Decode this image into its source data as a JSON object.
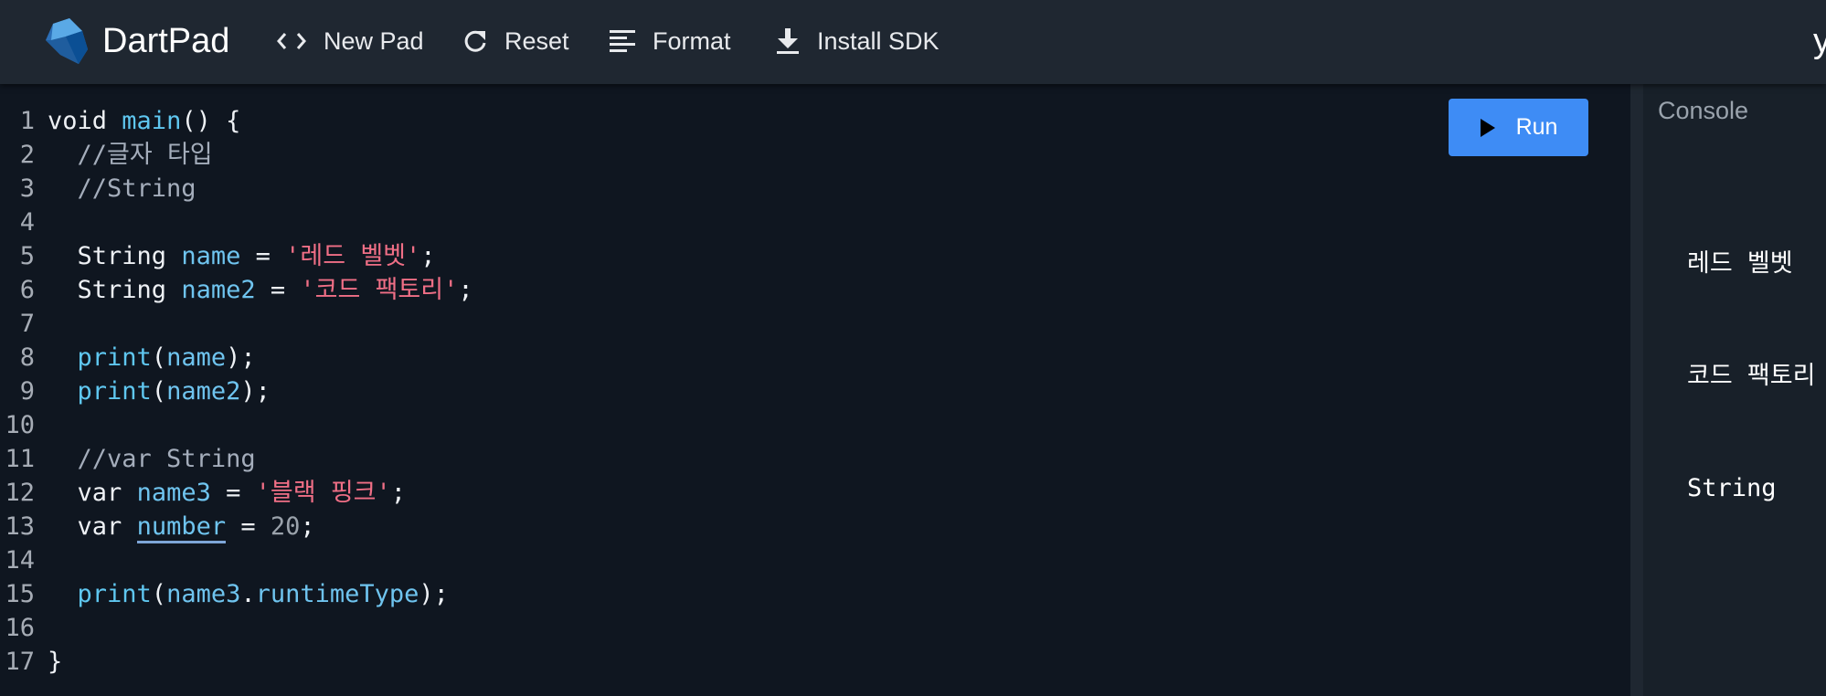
{
  "header": {
    "title": "DartPad",
    "new_pad": "New Pad",
    "reset": "Reset",
    "format": "Format",
    "install_sdk": "Install SDK",
    "cut_off_text": "y"
  },
  "editor": {
    "run_label": "Run",
    "lines": [
      {
        "n": "1"
      },
      {
        "n": "2"
      },
      {
        "n": "3"
      },
      {
        "n": "4"
      },
      {
        "n": "5"
      },
      {
        "n": "6"
      },
      {
        "n": "7"
      },
      {
        "n": "8"
      },
      {
        "n": "9"
      },
      {
        "n": "10"
      },
      {
        "n": "11"
      },
      {
        "n": "12"
      },
      {
        "n": "13"
      },
      {
        "n": "14"
      },
      {
        "n": "15"
      },
      {
        "n": "16"
      },
      {
        "n": "17"
      }
    ],
    "code": {
      "l1": {
        "kw": "void",
        "fn": "main",
        "rest": "() {"
      },
      "l2": {
        "comment": "//글자 타입"
      },
      "l3": {
        "comment": "//String"
      },
      "l5": {
        "type": "String",
        "id": "name",
        "eq": " = ",
        "str": "'레드 벨벳'",
        "end": ";"
      },
      "l6": {
        "type": "String",
        "id": "name2",
        "eq": " = ",
        "str": "'코드 팩토리'",
        "end": ";"
      },
      "l8": {
        "fn": "print",
        "open": "(",
        "arg": "name",
        "close": ");"
      },
      "l9": {
        "fn": "print",
        "open": "(",
        "arg": "name2",
        "close": ");"
      },
      "l11": {
        "comment": "//var String"
      },
      "l12": {
        "kw": "var",
        "id": "name3",
        "eq": " = ",
        "str": "'블랙 핑크'",
        "end": ";"
      },
      "l13": {
        "kw": "var",
        "id": "number",
        "eq": " = ",
        "num": "20",
        "end": ";"
      },
      "l15": {
        "fn": "print",
        "open": "(",
        "arg": "name3",
        "dot": ".",
        "prop": "runtimeType",
        "close": ");"
      },
      "l17": {
        "brace": "}"
      }
    }
  },
  "console": {
    "title": "Console",
    "output": [
      "레드 벨벳",
      "코드 팩토리",
      "String"
    ]
  },
  "colors": {
    "header_bg": "#1f2731",
    "editor_bg": "#0f1620",
    "console_bg": "#182029",
    "run_button": "#3e8cf5",
    "identifier": "#6fc4ef",
    "string": "#f06f86",
    "comment": "#a4adbb"
  },
  "icons": [
    "dart-logo-icon",
    "code-icon",
    "refresh-icon",
    "format-icon",
    "download-icon",
    "play-icon"
  ]
}
